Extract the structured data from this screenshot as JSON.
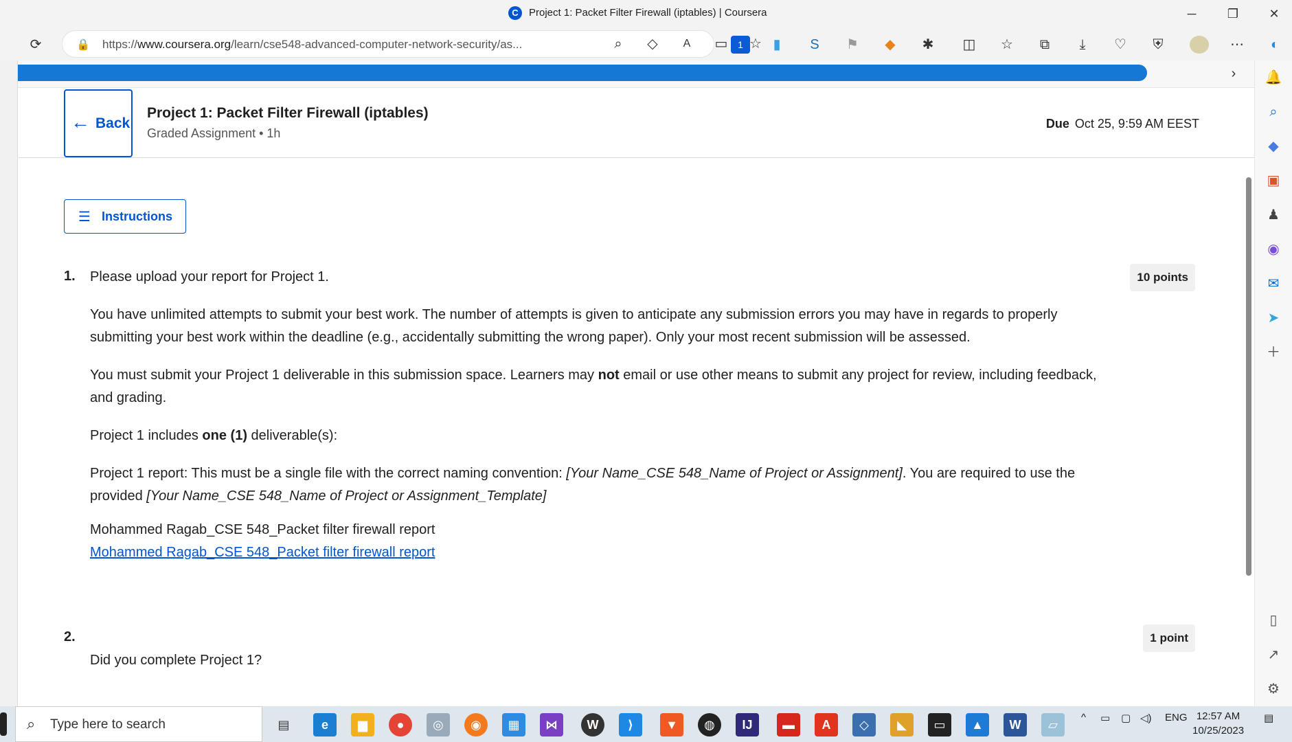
{
  "window": {
    "title": "Project 1: Packet Filter Firewall (iptables) | Coursera",
    "favicon_letter": "C",
    "minimize": "─",
    "restore": "❐",
    "close": "✕"
  },
  "browser": {
    "url_prefix": "https://",
    "url_domain": "www.coursera.org",
    "url_path": "/learn/cse548-advanced-computer-network-security/as...",
    "extension_badge": "1"
  },
  "header": {
    "back_label": "Back",
    "title": "Project 1: Packet Filter Firewall (iptables)",
    "subtitle": "Graded Assignment • 1h",
    "due_label": "Due",
    "due_value": "Oct 25, 9:59 AM EEST"
  },
  "instructions_label": "Instructions",
  "questions": [
    {
      "number": "1.",
      "points": "10 points",
      "prompt": "Please upload your report for Project 1.",
      "p1": "You have unlimited attempts to submit your best work. The number of attempts is given to anticipate any submission errors you may have in regards to properly submitting your best work within the deadline (e.g., accidentally submitting the wrong paper).  Only your most recent submission will be assessed.",
      "p2_a": "You must submit your Project 1 deliverable in this submission space. Learners may ",
      "p2_bold": "not",
      "p2_b": " email or use other means to submit any project for review, including feedback, and grading.",
      "p3_a": " Project 1 includes ",
      "p3_bold": "one (1)",
      "p3_b": " deliverable(s):",
      "p4_a": "Project 1 report: This must be a single file with the correct naming convention: ",
      "p4_i1": "[Your Name_CSE 548_Name of Project or Assignment]",
      "p4_b": ". You are required to use the provided ",
      "p4_i2": "[Your Name_CSE 548_Name of Project or Assignment_Template]",
      "file_name": "Mohammed Ragab_CSE 548_Packet filter firewall report",
      "file_link": "Mohammed Ragab_CSE 548_Packet filter firewall report"
    },
    {
      "number": "2.",
      "points": "1 point",
      "prompt": "Did you complete Project 1?"
    }
  ],
  "taskbar": {
    "search_placeholder": "Type here to search",
    "lang": "ENG",
    "time": "12:57 AM",
    "date": "10/25/2023"
  },
  "colors": {
    "accent": "#0056d2",
    "scribble": "#1478d4"
  }
}
